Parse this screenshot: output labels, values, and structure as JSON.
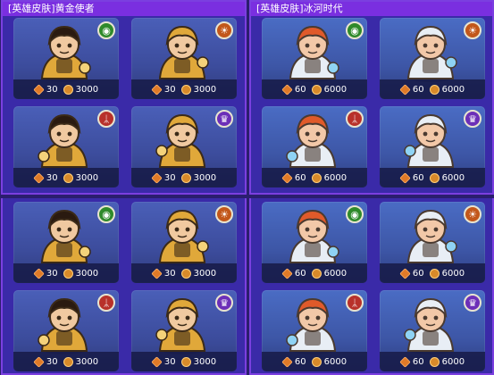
{
  "panels": [
    {
      "title": "[英雄皮肤]黄金使者",
      "cards": [
        {
          "badge": "green",
          "badge_icon": "eye-leaf-icon",
          "gem": "30",
          "gold": "3000",
          "palette": "gold-mask"
        },
        {
          "badge": "orange",
          "badge_icon": "sun-icon",
          "gem": "30",
          "gold": "3000",
          "palette": "gold-fox"
        },
        {
          "badge": "red",
          "badge_icon": "rune-icon",
          "gem": "30",
          "gold": "3000",
          "palette": "gold-bear"
        },
        {
          "badge": "purple",
          "badge_icon": "crown-icon",
          "gem": "30",
          "gold": "3000",
          "palette": "gold-musket"
        }
      ]
    },
    {
      "title": "[英雄皮肤]冰河时代",
      "cards": [
        {
          "badge": "green",
          "badge_icon": "eye-leaf-icon",
          "gem": "60",
          "gold": "6000",
          "palette": "ice-wolf"
        },
        {
          "badge": "orange",
          "badge_icon": "sun-icon",
          "gem": "60",
          "gold": "6000",
          "palette": "ice-viking"
        },
        {
          "badge": "red",
          "badge_icon": "rune-icon",
          "gem": "60",
          "gold": "6000",
          "palette": "ice-cat"
        },
        {
          "badge": "purple",
          "badge_icon": "crown-icon",
          "gem": "60",
          "gold": "6000",
          "palette": "ice-girl"
        }
      ]
    },
    {
      "title": "",
      "cards": [
        {
          "badge": "green",
          "badge_icon": "eye-leaf-icon",
          "gem": "30",
          "gold": "3000",
          "palette": "gold-knight"
        },
        {
          "badge": "orange",
          "badge_icon": "sun-icon",
          "gem": "30",
          "gold": "3000",
          "palette": "gold-lion"
        },
        {
          "badge": "red",
          "badge_icon": "rune-icon",
          "gem": "30",
          "gold": "3000",
          "palette": "gold-owl"
        },
        {
          "badge": "purple",
          "badge_icon": "crown-icon",
          "gem": "30",
          "gold": "3000",
          "palette": "gold-monkey"
        }
      ]
    },
    {
      "title": "",
      "cards": [
        {
          "badge": "green",
          "badge_icon": "eye-leaf-icon",
          "gem": "60",
          "gold": "6000",
          "palette": "ice-panda"
        },
        {
          "badge": "orange",
          "badge_icon": "sun-icon",
          "gem": "60",
          "gold": "6000",
          "palette": "ice-yeti"
        },
        {
          "badge": "red",
          "badge_icon": "rune-icon",
          "gem": "60",
          "gold": "6000",
          "palette": "ice-penguin"
        },
        {
          "badge": "purple",
          "badge_icon": "crown-icon",
          "gem": "60",
          "gold": "6000",
          "palette": "ice-robot"
        }
      ]
    }
  ],
  "colors": {
    "background": "#2b1e6e",
    "panel": "#3a2aa8",
    "panel_border": "#7b3fe0",
    "gold_skin": "#e0a83a",
    "ice_skin": "#e8eef5"
  }
}
